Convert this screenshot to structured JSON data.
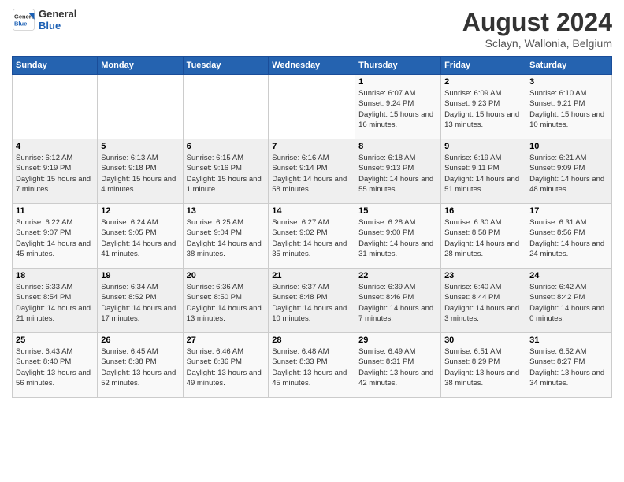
{
  "header": {
    "logo_general": "General",
    "logo_blue": "Blue",
    "main_title": "August 2024",
    "subtitle": "Sclayn, Wallonia, Belgium"
  },
  "weekdays": [
    "Sunday",
    "Monday",
    "Tuesday",
    "Wednesday",
    "Thursday",
    "Friday",
    "Saturday"
  ],
  "weeks": [
    [
      {
        "day": "",
        "info": ""
      },
      {
        "day": "",
        "info": ""
      },
      {
        "day": "",
        "info": ""
      },
      {
        "day": "",
        "info": ""
      },
      {
        "day": "1",
        "info": "Sunrise: 6:07 AM\nSunset: 9:24 PM\nDaylight: 15 hours and 16 minutes."
      },
      {
        "day": "2",
        "info": "Sunrise: 6:09 AM\nSunset: 9:23 PM\nDaylight: 15 hours and 13 minutes."
      },
      {
        "day": "3",
        "info": "Sunrise: 6:10 AM\nSunset: 9:21 PM\nDaylight: 15 hours and 10 minutes."
      }
    ],
    [
      {
        "day": "4",
        "info": "Sunrise: 6:12 AM\nSunset: 9:19 PM\nDaylight: 15 hours and 7 minutes."
      },
      {
        "day": "5",
        "info": "Sunrise: 6:13 AM\nSunset: 9:18 PM\nDaylight: 15 hours and 4 minutes."
      },
      {
        "day": "6",
        "info": "Sunrise: 6:15 AM\nSunset: 9:16 PM\nDaylight: 15 hours and 1 minute."
      },
      {
        "day": "7",
        "info": "Sunrise: 6:16 AM\nSunset: 9:14 PM\nDaylight: 14 hours and 58 minutes."
      },
      {
        "day": "8",
        "info": "Sunrise: 6:18 AM\nSunset: 9:13 PM\nDaylight: 14 hours and 55 minutes."
      },
      {
        "day": "9",
        "info": "Sunrise: 6:19 AM\nSunset: 9:11 PM\nDaylight: 14 hours and 51 minutes."
      },
      {
        "day": "10",
        "info": "Sunrise: 6:21 AM\nSunset: 9:09 PM\nDaylight: 14 hours and 48 minutes."
      }
    ],
    [
      {
        "day": "11",
        "info": "Sunrise: 6:22 AM\nSunset: 9:07 PM\nDaylight: 14 hours and 45 minutes."
      },
      {
        "day": "12",
        "info": "Sunrise: 6:24 AM\nSunset: 9:05 PM\nDaylight: 14 hours and 41 minutes."
      },
      {
        "day": "13",
        "info": "Sunrise: 6:25 AM\nSunset: 9:04 PM\nDaylight: 14 hours and 38 minutes."
      },
      {
        "day": "14",
        "info": "Sunrise: 6:27 AM\nSunset: 9:02 PM\nDaylight: 14 hours and 35 minutes."
      },
      {
        "day": "15",
        "info": "Sunrise: 6:28 AM\nSunset: 9:00 PM\nDaylight: 14 hours and 31 minutes."
      },
      {
        "day": "16",
        "info": "Sunrise: 6:30 AM\nSunset: 8:58 PM\nDaylight: 14 hours and 28 minutes."
      },
      {
        "day": "17",
        "info": "Sunrise: 6:31 AM\nSunset: 8:56 PM\nDaylight: 14 hours and 24 minutes."
      }
    ],
    [
      {
        "day": "18",
        "info": "Sunrise: 6:33 AM\nSunset: 8:54 PM\nDaylight: 14 hours and 21 minutes."
      },
      {
        "day": "19",
        "info": "Sunrise: 6:34 AM\nSunset: 8:52 PM\nDaylight: 14 hours and 17 minutes."
      },
      {
        "day": "20",
        "info": "Sunrise: 6:36 AM\nSunset: 8:50 PM\nDaylight: 14 hours and 13 minutes."
      },
      {
        "day": "21",
        "info": "Sunrise: 6:37 AM\nSunset: 8:48 PM\nDaylight: 14 hours and 10 minutes."
      },
      {
        "day": "22",
        "info": "Sunrise: 6:39 AM\nSunset: 8:46 PM\nDaylight: 14 hours and 7 minutes."
      },
      {
        "day": "23",
        "info": "Sunrise: 6:40 AM\nSunset: 8:44 PM\nDaylight: 14 hours and 3 minutes."
      },
      {
        "day": "24",
        "info": "Sunrise: 6:42 AM\nSunset: 8:42 PM\nDaylight: 14 hours and 0 minutes."
      }
    ],
    [
      {
        "day": "25",
        "info": "Sunrise: 6:43 AM\nSunset: 8:40 PM\nDaylight: 13 hours and 56 minutes."
      },
      {
        "day": "26",
        "info": "Sunrise: 6:45 AM\nSunset: 8:38 PM\nDaylight: 13 hours and 52 minutes."
      },
      {
        "day": "27",
        "info": "Sunrise: 6:46 AM\nSunset: 8:36 PM\nDaylight: 13 hours and 49 minutes."
      },
      {
        "day": "28",
        "info": "Sunrise: 6:48 AM\nSunset: 8:33 PM\nDaylight: 13 hours and 45 minutes."
      },
      {
        "day": "29",
        "info": "Sunrise: 6:49 AM\nSunset: 8:31 PM\nDaylight: 13 hours and 42 minutes."
      },
      {
        "day": "30",
        "info": "Sunrise: 6:51 AM\nSunset: 8:29 PM\nDaylight: 13 hours and 38 minutes."
      },
      {
        "day": "31",
        "info": "Sunrise: 6:52 AM\nSunset: 8:27 PM\nDaylight: 13 hours and 34 minutes."
      }
    ]
  ]
}
